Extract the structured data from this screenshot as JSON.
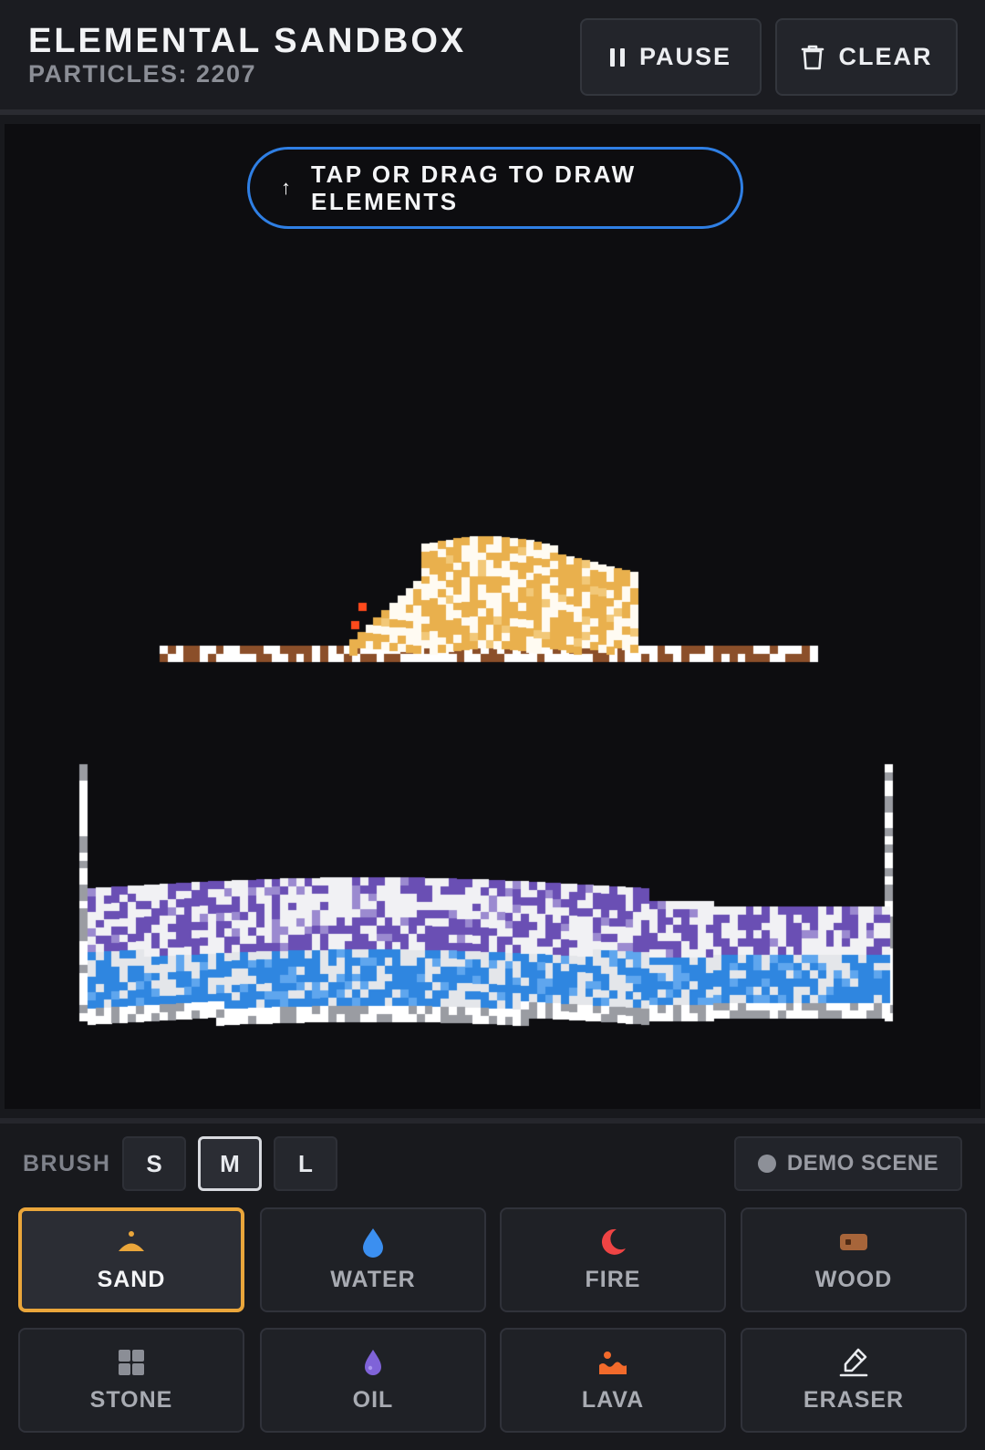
{
  "header": {
    "title": "ELEMENTAL SANDBOX",
    "particles_label": "PARTICLES: 2207",
    "pause_label": "PAUSE",
    "clear_label": "CLEAR"
  },
  "canvas": {
    "hint_line1": "TAP OR DRAG TO DRAW",
    "hint_line2": "ELEMENTS"
  },
  "controls": {
    "brush_label": "BRUSH",
    "brush_sizes": [
      "S",
      "M",
      "L"
    ],
    "selected_brush": "M",
    "demo_label": "DEMO SCENE",
    "elements": [
      {
        "label": "SAND",
        "icon": "sand-icon",
        "color": "#eaa63b"
      },
      {
        "label": "WATER",
        "icon": "water-drop-icon",
        "color": "#3b8ff0"
      },
      {
        "label": "FIRE",
        "icon": "fire-icon",
        "color": "#ef4444"
      },
      {
        "label": "WOOD",
        "icon": "wood-icon",
        "color": "#a7653a"
      },
      {
        "label": "STONE",
        "icon": "stone-icon",
        "color": "#8b8e96"
      },
      {
        "label": "OIL",
        "icon": "oil-drop-icon",
        "color": "#7f63d8"
      },
      {
        "label": "LAVA",
        "icon": "lava-icon",
        "color": "#f26a2b"
      },
      {
        "label": "ERASER",
        "icon": "eraser-icon",
        "color": "#e8eaee"
      }
    ],
    "selected_element": "SAND"
  },
  "colors": {
    "accent_blue": "#2f7fe4",
    "selected_gold": "#eaa63b",
    "sand": "#e9b04d",
    "water": "#2f86e0",
    "oil": "#6a4fb4",
    "wood": "#8b4f2a",
    "stone": "#9a9ca2",
    "lava": "#ff4a1c"
  }
}
